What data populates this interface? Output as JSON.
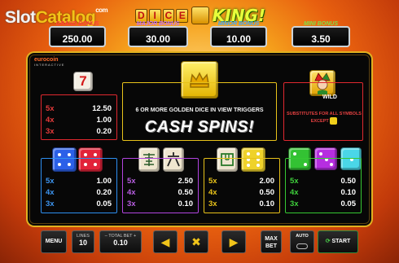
{
  "site": {
    "logo_part1": "Slot",
    "logo_part2": "Catalog",
    "logo_suffix": "com"
  },
  "game": {
    "title_letters": [
      "D",
      "I",
      "C",
      "E"
    ],
    "title_word": "KING!"
  },
  "jackpots": [
    {
      "label": "GRAND BONUS",
      "value": "250.00"
    },
    {
      "label": "MAJOR BONUS",
      "value": "30.00"
    },
    {
      "label": "MINOR BONUS",
      "value": "10.00"
    },
    {
      "label": "MINI BONUS",
      "value": "3.50"
    }
  ],
  "provider": {
    "name": "eurocoin",
    "tagline": "INTERACTIVE"
  },
  "paytables": {
    "seven": [
      {
        "mult": "5x",
        "value": "12.50"
      },
      {
        "mult": "4x",
        "value": "1.00"
      },
      {
        "mult": "3x",
        "value": "0.20"
      }
    ],
    "blue_red": [
      {
        "mult": "5x",
        "value": "1.00"
      },
      {
        "mult": "4x",
        "value": "0.20"
      },
      {
        "mult": "3x",
        "value": "0.05"
      }
    ],
    "mahjong_six": [
      {
        "mult": "5x",
        "value": "2.50"
      },
      {
        "mult": "4x",
        "value": "0.50"
      },
      {
        "mult": "3x",
        "value": "0.10"
      }
    ],
    "mahjong_four": [
      {
        "mult": "5x",
        "value": "2.00"
      },
      {
        "mult": "4x",
        "value": "0.50"
      },
      {
        "mult": "3x",
        "value": "0.10"
      }
    ],
    "green_purple_cyan": [
      {
        "mult": "5x",
        "value": "0.50"
      },
      {
        "mult": "4x",
        "value": "0.10"
      },
      {
        "mult": "3x",
        "value": "0.05"
      }
    ]
  },
  "feature": {
    "trigger_text": "6 OR MORE GOLDEN DICE IN VIEW TRIGGERS",
    "title": "CASH SPINS!"
  },
  "wild": {
    "label": "WILD",
    "substitute_text": "SUBSTITUTES FOR ALL SYMBOLS EXCEPT"
  },
  "controls": {
    "menu": "MENU",
    "lines_label": "LINES",
    "lines_value": "10",
    "total_bet_label": "TOTAL BET",
    "total_bet_value": "0.10",
    "max_bet": "MAX BET",
    "auto": "AUTO",
    "start": "START"
  },
  "colors": {
    "red": "#e0282f",
    "yellow": "#e8c21a",
    "blue": "#2d8ff0",
    "purple": "#b244e0",
    "green": "#36c832"
  }
}
